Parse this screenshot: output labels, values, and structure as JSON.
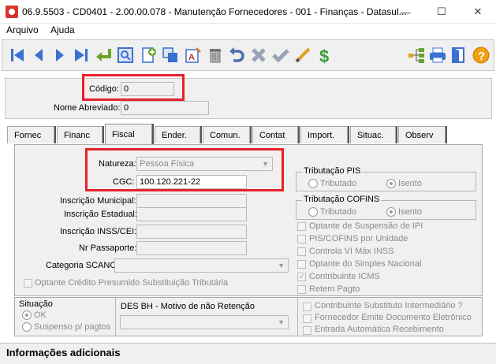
{
  "window": {
    "title": "06.9.5503 - CD0401 - 2.00.00.078 - Manutenção Fornecedores - 001 - Finanças - Datasul...",
    "minimize": "—",
    "maximize": "☐",
    "close": "✕"
  },
  "menu": {
    "items": [
      "Arquivo",
      "Ajuda"
    ]
  },
  "toolbar": {
    "icons": [
      "first-icon",
      "previous-icon",
      "next-icon",
      "last-icon",
      "goto-icon",
      "search-icon",
      "add-icon",
      "copy-icon",
      "edit-icon",
      "delete-icon",
      "undo-icon",
      "cancel-icon",
      "confirm-icon",
      "pencil-icon",
      "money-icon",
      "hierarchy-icon",
      "print-icon",
      "exit-icon",
      "help-icon"
    ]
  },
  "header": {
    "codigo_label": "Código:",
    "codigo_value": "0",
    "nome_label": "Nome Abreviado:",
    "nome_value": "0"
  },
  "tabs": [
    "Fornec",
    "Financ",
    "Fiscal",
    "Ender.",
    "Comun.",
    "Contat",
    "Import.",
    "Situac.",
    "Observ"
  ],
  "active_tab": "Fiscal",
  "fiscal": {
    "natureza_label": "Natureza:",
    "natureza_value": "Pessoa Física",
    "cgc_label": "CGC:",
    "cgc_value": "100.120.221-22",
    "insc_municipal_label": "Inscrição Municipal:",
    "insc_estadual_label": "Inscrição Estadual:",
    "insc_inss_label": "Inscrição INSS/CEI:",
    "passaporte_label": "Nr Passaporte:",
    "categoria_label": "Categoria SCANC:",
    "credito_presumido": "Optante Crédito Presumido Substituição Tributária",
    "tributacao_pis": {
      "title": "Tributação PIS",
      "opt1": "Tributado",
      "opt2": "Isento"
    },
    "tributacao_cofins": {
      "title": "Tributação COFINS",
      "opt1": "Tributado",
      "opt2": "Isento"
    },
    "checks": [
      "Optante de Suspensão de IPI",
      "PIS/COFINS por Unidade",
      "Controla VI Máx INSS",
      "Optante do Simples Nacional",
      "Contribuinte ICMS",
      "Retem Pagto"
    ]
  },
  "bottom": {
    "situacao_title": "Situação",
    "situacao_ok": "OK",
    "situacao_suspenso": "Suspenso p/ pagtos",
    "desbh_label": "DES BH - Motivo de não Retenção",
    "checks": [
      "Contribuinte Substituto Intermediário ?",
      "Fornecedor Emite Documento Eletrônico",
      "Entrada Automática Recebimento"
    ]
  },
  "status": {
    "text": "Informações adicionais"
  },
  "colors": {
    "highlight": "#e8202a",
    "panel": "#f0f0f0"
  }
}
